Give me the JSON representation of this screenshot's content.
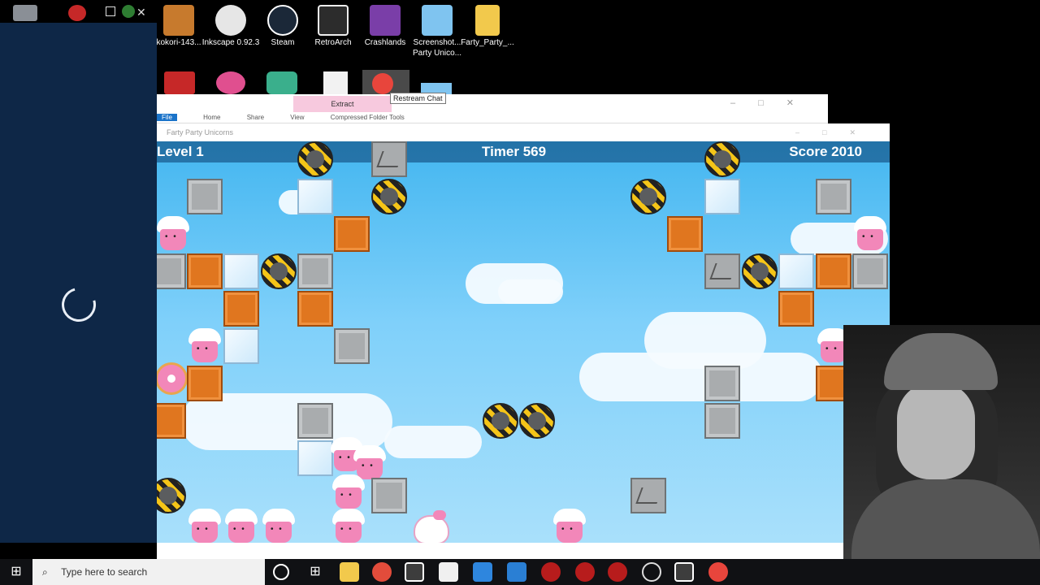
{
  "desktop": {
    "icons": [
      {
        "label": "kokori-143...",
        "color": "#c77a2d"
      },
      {
        "label": "Inkscape 0.92.3",
        "color": "#e6e6e6"
      },
      {
        "label": "Steam",
        "color": "#1b2838"
      },
      {
        "label": "RetroArch",
        "color": "#2c2c2c"
      },
      {
        "label": "Crashlands",
        "color": "#7a3ea8"
      },
      {
        "label": "Screenshot... Party Unico...",
        "color": "#7fc4f0"
      },
      {
        "label": "Farty_Party_...",
        "color": "#f2c94c"
      }
    ],
    "second_row_icons": [
      "pdf-icon",
      "paint-icon",
      "streamlabs-icon",
      "document-icon",
      "restream-icon",
      "image-icon"
    ]
  },
  "tooltip": "Restream Chat",
  "explorer": {
    "extract_label": "Extract",
    "tabs": [
      "File",
      "Home",
      "Share",
      "View",
      "Compressed Folder Tools"
    ]
  },
  "game": {
    "window_title": "Farty Party Unicorns",
    "hud": {
      "level": "Level 1",
      "timer": "Timer 569",
      "score": "Score 2010"
    }
  },
  "taskbar": {
    "search_placeholder": "Type here to search",
    "apps": [
      "cortana-icon",
      "task-view-icon",
      "file-explorer-icon",
      "chrome-icon",
      "gamemaker-icon",
      "twitch-icon",
      "affinity-icon",
      "vscode-icon",
      "app-icon",
      "app-icon",
      "app-icon",
      "obs-icon",
      "gamemaker-icon",
      "restream-icon"
    ]
  }
}
